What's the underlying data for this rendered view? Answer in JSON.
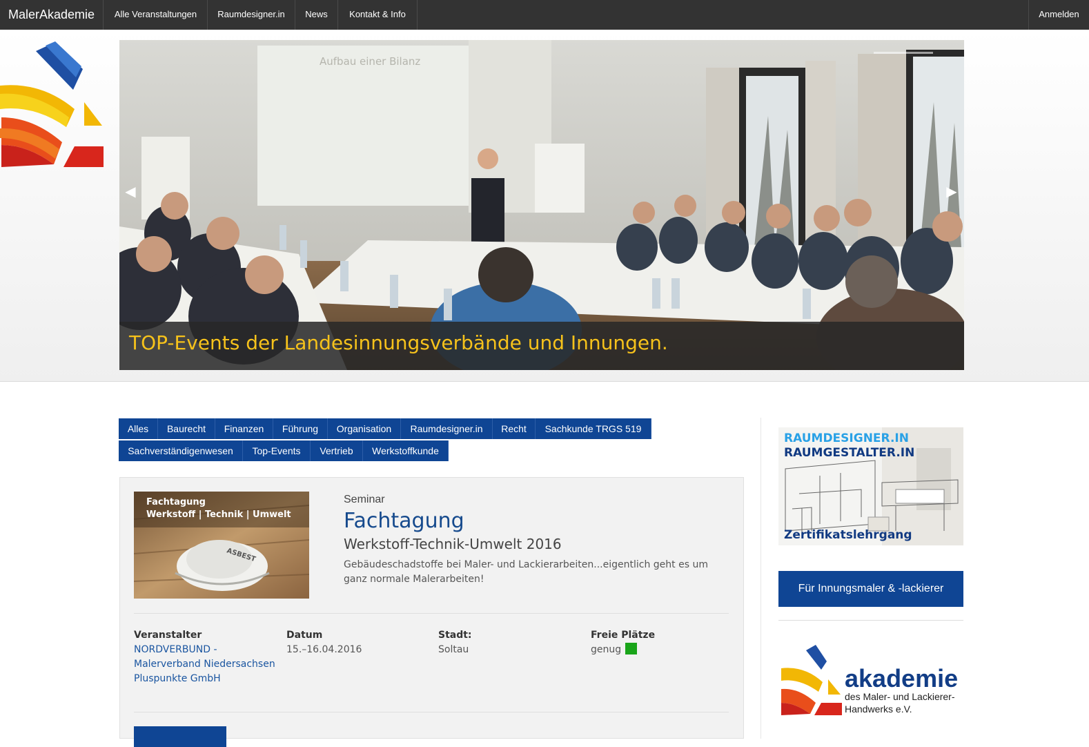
{
  "navbar": {
    "brand": "MalerAkademie",
    "items": [
      {
        "label": "Alle Veranstaltungen"
      },
      {
        "label": "Raumdesigner.in"
      },
      {
        "label": "News"
      },
      {
        "label": "Kontakt & Info"
      }
    ],
    "login": "Anmelden"
  },
  "hero": {
    "slide_caption": "TOP-Events der Landesinnungsverbände und Innungen.",
    "projection_text": "Aufbau einer Bilanz",
    "prev_icon": "chevron-left-icon",
    "next_icon": "chevron-right-icon"
  },
  "filter": {
    "categories": [
      "Alles",
      "Baurecht",
      "Finanzen",
      "Führung",
      "Organisation",
      "Raumdesigner.in",
      "Recht",
      "Sachkunde TRGS 519",
      "Sachverständigenwesen",
      "Top-Events",
      "Vertrieb",
      "Werkstoffkunde"
    ]
  },
  "event": {
    "image_text_line1": "Fachtagung",
    "image_text_line2": "Werkstoff | Technik | Umwelt",
    "image_mask_text": "ASBEST",
    "type": "Seminar",
    "title": "Fachtagung",
    "subtitle": "Werkstoff-Technik-Umwelt 2016",
    "description": "Gebäudeschadstoffe bei Maler- und Lackierarbeiten...eigentlich geht es um ganz normale Malerarbeiten!",
    "organizer_label": "Veranstalter",
    "organizer_lines": [
      "NORDVERBUND -",
      "Malerverband Niedersachsen",
      "Pluspunkte GmbH"
    ],
    "date_label": "Datum",
    "date_value": "15.–16.04.2016",
    "city_label": "Stadt:",
    "city_value": "Soltau",
    "seats_label": "Freie Plätze",
    "seats_value": "genug",
    "seats_color": "#1aa51a"
  },
  "sidebar": {
    "banner_line1": "RAUMDESIGNER.IN",
    "banner_line2": "RAUMGESTALTER.IN",
    "banner_line3": "Zertifikatslehrgang",
    "innung_button": "Für Innungsmaler & -lackierer",
    "akademie_word": "akademie",
    "akademie_sub1": "des Maler- und Lackierer-",
    "akademie_sub2": "Handwerks e.V."
  },
  "colors": {
    "navbar": "#333333",
    "primary_blue": "#0f4594",
    "caption_yellow": "#f6c21b",
    "title_blue": "#164a8d"
  }
}
